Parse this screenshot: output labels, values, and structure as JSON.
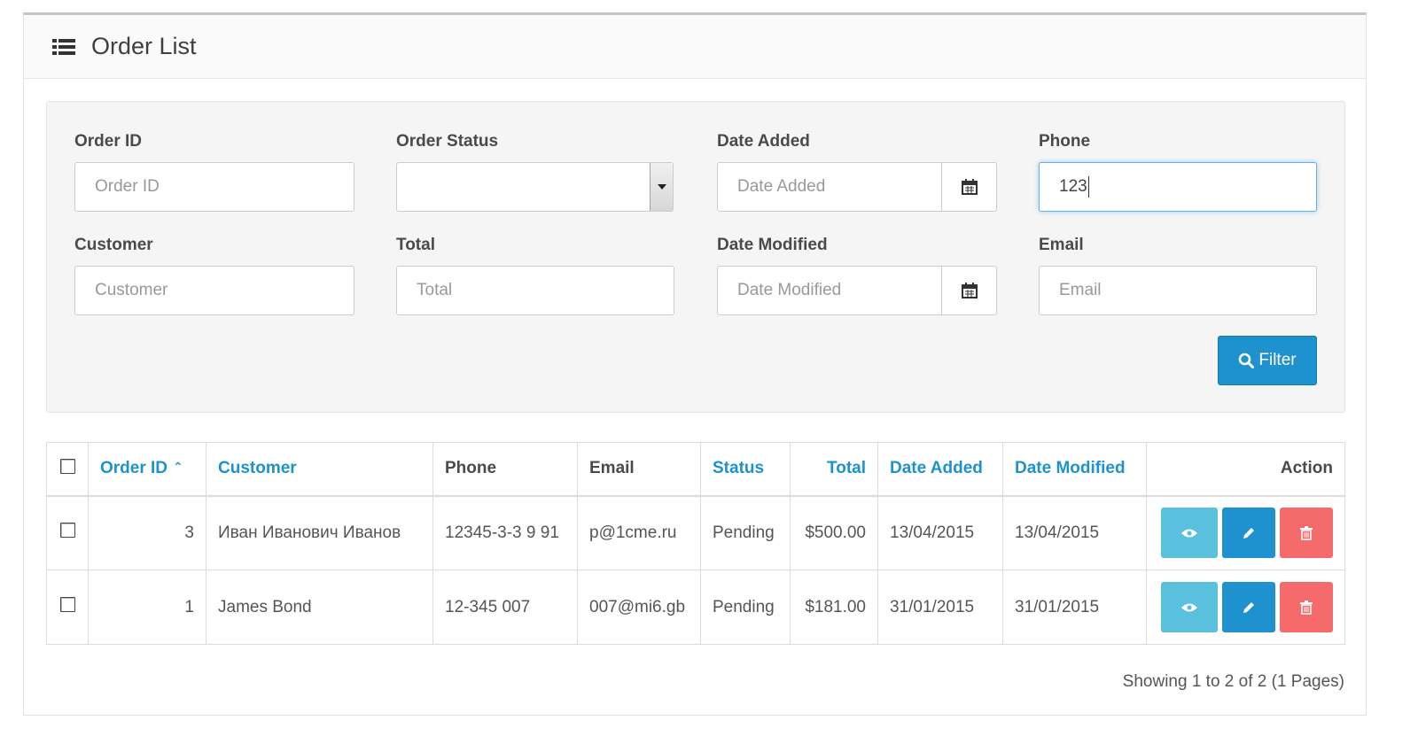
{
  "header": {
    "title": "Order List",
    "icon": "list-icon"
  },
  "filters": {
    "order_id": {
      "label": "Order ID",
      "placeholder": "Order ID",
      "value": ""
    },
    "order_status": {
      "label": "Order Status",
      "value": ""
    },
    "date_added": {
      "label": "Date Added",
      "placeholder": "Date Added",
      "value": ""
    },
    "phone": {
      "label": "Phone",
      "value": "123"
    },
    "customer": {
      "label": "Customer",
      "placeholder": "Customer",
      "value": ""
    },
    "total": {
      "label": "Total",
      "placeholder": "Total",
      "value": ""
    },
    "date_modified": {
      "label": "Date Modified",
      "placeholder": "Date Modified",
      "value": ""
    },
    "email": {
      "label": "Email",
      "placeholder": "Email",
      "value": ""
    },
    "filter_button": "Filter"
  },
  "table": {
    "columns": {
      "order_id": "Order ID",
      "customer": "Customer",
      "phone": "Phone",
      "email": "Email",
      "status": "Status",
      "total": "Total",
      "date_added": "Date Added",
      "date_modified": "Date Modified",
      "action": "Action"
    },
    "sort_indicator": "^",
    "rows": [
      {
        "order_id": "3",
        "customer": "Иван Иванович Иванов",
        "phone": "12345-3-3 9 91",
        "email": "p@1cme.ru",
        "status": "Pending",
        "total": "$500.00",
        "date_added": "13/04/2015",
        "date_modified": "13/04/2015"
      },
      {
        "order_id": "1",
        "customer": "James Bond",
        "phone": "12-345 007",
        "email": "007@mi6.gb",
        "status": "Pending",
        "total": "$181.00",
        "date_added": "31/01/2015",
        "date_modified": "31/01/2015"
      }
    ]
  },
  "pagination": {
    "summary": "Showing 1 to 2 of 2 (1 Pages)"
  },
  "colors": {
    "primary": "#1e91cf",
    "info": "#5bc0de",
    "danger": "#f56b6b",
    "link": "#1e91cf"
  }
}
